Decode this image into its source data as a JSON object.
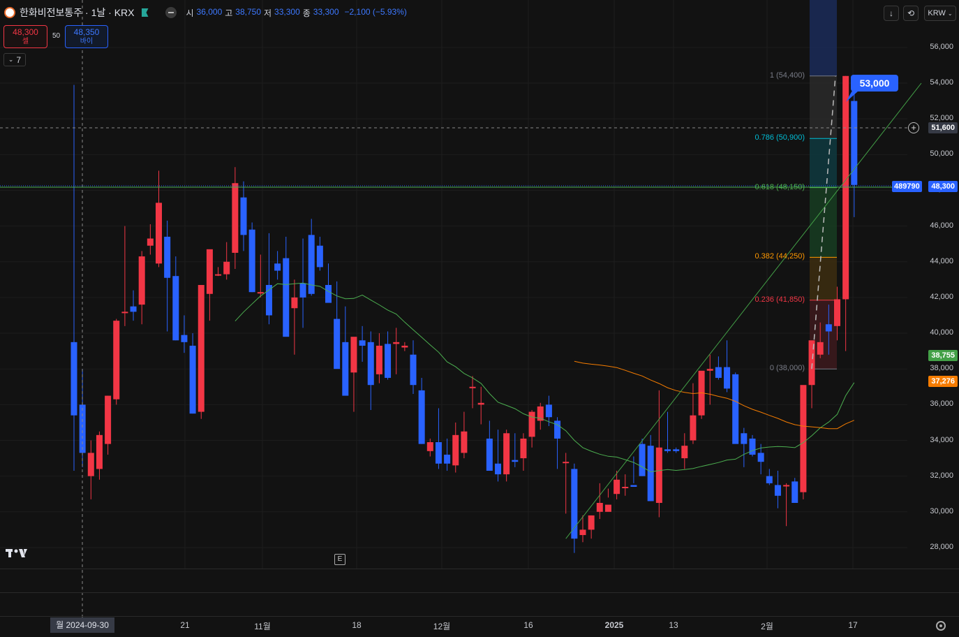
{
  "header": {
    "symbol_title": "한화비전보통주 · 1날 · KRX",
    "ohlc": [
      {
        "k": "시",
        "v": "36,000"
      },
      {
        "k": "고",
        "v": "38,750"
      },
      {
        "k": "저",
        "v": "33,300"
      },
      {
        "k": "종",
        "v": "33,300"
      },
      {
        "k": "",
        "v": "−2,100 (−5.93%)"
      }
    ],
    "sell_price": "48,300",
    "sell_label": "셀",
    "spread": "50",
    "buy_price": "48,350",
    "buy_label": "바이",
    "indicator_count": "7",
    "currency": "KRW"
  },
  "toolbar": {
    "download_icon": "↓",
    "refresh_icon": "⟲"
  },
  "price_axis": {
    "ticks": [
      "56,000",
      "54,000",
      "52,000",
      "50,000",
      "48,000",
      "46,000",
      "44,000",
      "42,000",
      "40,000",
      "38,000",
      "36,000",
      "34,000",
      "32,000",
      "30,000",
      "28,000"
    ],
    "crosshair_price": "51,600",
    "last_price": "48,300",
    "last_volume_tag": "489790",
    "ma_green_value": "38,755",
    "ma_orange_value": "37,276",
    "callout_price": "53,000"
  },
  "time_axis": {
    "ticks": [
      "21",
      "11월",
      "18",
      "12월",
      "16",
      "2025",
      "13",
      "2월",
      "17"
    ],
    "crosshair_date": "월 2024-09-30"
  },
  "fib": [
    {
      "label": "1 (54,400)",
      "color": "#787b86"
    },
    {
      "label": "0.786 (50,900)",
      "color": "#00bcd4"
    },
    {
      "label": "0.618 (48,150)",
      "color": "#4caf50"
    },
    {
      "label": "0.382 (44,250)",
      "color": "#ff9800"
    },
    {
      "label": "0.236 (41,850)",
      "color": "#f23645"
    },
    {
      "label": "0 (38,000)",
      "color": "#787b86"
    }
  ],
  "colors": {
    "up": "#f23645",
    "down": "#2962ff",
    "ma_green": "#4caf50",
    "ma_orange": "#f57c00",
    "background": "#121212"
  },
  "chart_data": {
    "type": "candlestick",
    "ylim": [
      27500,
      57000
    ],
    "candles": [
      {
        "o": 39500,
        "h": 53900,
        "l": 32300,
        "c": 35400
      },
      {
        "o": 36000,
        "h": 38000,
        "l": 32500,
        "c": 33300
      },
      {
        "o": 32000,
        "h": 34000,
        "l": 30700,
        "c": 33300
      },
      {
        "o": 32400,
        "h": 34500,
        "l": 31800,
        "c": 34300
      },
      {
        "o": 33800,
        "h": 36500,
        "l": 33200,
        "c": 36500
      },
      {
        "o": 36300,
        "h": 40800,
        "l": 36000,
        "c": 40700
      },
      {
        "o": 41200,
        "h": 46000,
        "l": 40400,
        "c": 41200
      },
      {
        "o": 41500,
        "h": 42400,
        "l": 40700,
        "c": 41200
      },
      {
        "o": 41600,
        "h": 44600,
        "l": 40500,
        "c": 44300
      },
      {
        "o": 44900,
        "h": 46100,
        "l": 44400,
        "c": 45300
      },
      {
        "o": 43900,
        "h": 49100,
        "l": 43700,
        "c": 47300
      },
      {
        "o": 45400,
        "h": 46300,
        "l": 40100,
        "c": 43100
      },
      {
        "o": 43200,
        "h": 44300,
        "l": 39600,
        "c": 39600
      },
      {
        "o": 39900,
        "h": 41000,
        "l": 38900,
        "c": 39500
      },
      {
        "o": 39300,
        "h": 40000,
        "l": 35500,
        "c": 35500
      },
      {
        "o": 35600,
        "h": 41600,
        "l": 35200,
        "c": 42700
      },
      {
        "o": 42200,
        "h": 44300,
        "l": 40700,
        "c": 44700
      },
      {
        "o": 43300,
        "h": 43700,
        "l": 43200,
        "c": 43300
      },
      {
        "o": 43300,
        "h": 45100,
        "l": 43000,
        "c": 44000
      },
      {
        "o": 44500,
        "h": 49300,
        "l": 43600,
        "c": 48400
      },
      {
        "o": 47600,
        "h": 48500,
        "l": 44600,
        "c": 45500
      },
      {
        "o": 45800,
        "h": 46200,
        "l": 42300,
        "c": 42300
      },
      {
        "o": 42300,
        "h": 44400,
        "l": 42000,
        "c": 42300
      },
      {
        "o": 42700,
        "h": 45600,
        "l": 40500,
        "c": 41000
      },
      {
        "o": 43900,
        "h": 44600,
        "l": 43000,
        "c": 43500
      },
      {
        "o": 44200,
        "h": 45400,
        "l": 41100,
        "c": 39800
      },
      {
        "o": 41400,
        "h": 43000,
        "l": 38800,
        "c": 42000
      },
      {
        "o": 42800,
        "h": 45300,
        "l": 40300,
        "c": 42000
      },
      {
        "o": 45500,
        "h": 46400,
        "l": 42100,
        "c": 42200
      },
      {
        "o": 44900,
        "h": 45400,
        "l": 43500,
        "c": 43700
      },
      {
        "o": 42700,
        "h": 43900,
        "l": 41800,
        "c": 41700
      },
      {
        "o": 40800,
        "h": 42900,
        "l": 38300,
        "c": 38000
      },
      {
        "o": 39500,
        "h": 41500,
        "l": 38700,
        "c": 36500
      },
      {
        "o": 37800,
        "h": 39300,
        "l": 35600,
        "c": 39800
      },
      {
        "o": 39600,
        "h": 40400,
        "l": 38400,
        "c": 39300
      },
      {
        "o": 39500,
        "h": 40100,
        "l": 35700,
        "c": 37100
      },
      {
        "o": 37700,
        "h": 40000,
        "l": 37200,
        "c": 39300
      },
      {
        "o": 39400,
        "h": 40100,
        "l": 37400,
        "c": 37500
      },
      {
        "o": 39400,
        "h": 40300,
        "l": 37700,
        "c": 39500
      },
      {
        "o": 39200,
        "h": 39500,
        "l": 39000,
        "c": 39300
      },
      {
        "o": 38800,
        "h": 39600,
        "l": 36600,
        "c": 37100
      },
      {
        "o": 36800,
        "h": 37500,
        "l": 33800,
        "c": 33800
      },
      {
        "o": 33400,
        "h": 34100,
        "l": 33100,
        "c": 33900
      },
      {
        "o": 33900,
        "h": 35800,
        "l": 32400,
        "c": 32700
      },
      {
        "o": 33200,
        "h": 34100,
        "l": 32300,
        "c": 32700
      },
      {
        "o": 32600,
        "h": 35000,
        "l": 32200,
        "c": 34300
      },
      {
        "o": 33300,
        "h": 35600,
        "l": 33000,
        "c": 34500
      },
      {
        "o": 37000,
        "h": 37600,
        "l": 35800,
        "c": 37000
      },
      {
        "o": 36000,
        "h": 37000,
        "l": 34900,
        "c": 36100
      },
      {
        "o": 34100,
        "h": 35100,
        "l": 32600,
        "c": 32300
      },
      {
        "o": 32700,
        "h": 34600,
        "l": 31700,
        "c": 32100
      },
      {
        "o": 32100,
        "h": 34600,
        "l": 31700,
        "c": 34400
      },
      {
        "o": 32900,
        "h": 34400,
        "l": 32500,
        "c": 32800
      },
      {
        "o": 33000,
        "h": 34400,
        "l": 32300,
        "c": 34100
      },
      {
        "o": 34200,
        "h": 35700,
        "l": 33600,
        "c": 35600
      },
      {
        "o": 35100,
        "h": 36100,
        "l": 34600,
        "c": 35900
      },
      {
        "o": 36000,
        "h": 36500,
        "l": 34800,
        "c": 35300
      },
      {
        "o": 35100,
        "h": 35300,
        "l": 32400,
        "c": 34100
      },
      {
        "o": 32800,
        "h": 33300,
        "l": 29900,
        "c": 32800
      },
      {
        "o": 32400,
        "h": 32700,
        "l": 27700,
        "c": 28500
      },
      {
        "o": 28700,
        "h": 29800,
        "l": 28300,
        "c": 29000
      },
      {
        "o": 29000,
        "h": 29800,
        "l": 28500,
        "c": 29800
      },
      {
        "o": 30000,
        "h": 31600,
        "l": 29600,
        "c": 30500
      },
      {
        "o": 30000,
        "h": 31300,
        "l": 30800,
        "c": 30400
      },
      {
        "o": 31000,
        "h": 32300,
        "l": 30700,
        "c": 31800
      },
      {
        "o": 31400,
        "h": 32100,
        "l": 30900,
        "c": 31400
      },
      {
        "o": 31500,
        "h": 33100,
        "l": 31600,
        "c": 31400
      },
      {
        "o": 33800,
        "h": 34100,
        "l": 32000,
        "c": 32000
      },
      {
        "o": 33700,
        "h": 34300,
        "l": 30600,
        "c": 30600
      },
      {
        "o": 30500,
        "h": 36800,
        "l": 29700,
        "c": 33600
      },
      {
        "o": 33500,
        "h": 35600,
        "l": 33300,
        "c": 33400
      },
      {
        "o": 33500,
        "h": 33600,
        "l": 33300,
        "c": 33400
      },
      {
        "o": 33000,
        "h": 34400,
        "l": 32400,
        "c": 33700
      },
      {
        "o": 34000,
        "h": 37200,
        "l": 33800,
        "c": 35400
      },
      {
        "o": 35400,
        "h": 37200,
        "l": 35200,
        "c": 37900
      },
      {
        "o": 37900,
        "h": 38800,
        "l": 36000,
        "c": 38000
      },
      {
        "o": 38100,
        "h": 38700,
        "l": 37400,
        "c": 37500
      },
      {
        "o": 38100,
        "h": 39600,
        "l": 36700,
        "c": 36900
      },
      {
        "o": 37700,
        "h": 37800,
        "l": 34900,
        "c": 33800
      },
      {
        "o": 34400,
        "h": 34700,
        "l": 32500,
        "c": 33800
      },
      {
        "o": 34100,
        "h": 34300,
        "l": 33100,
        "c": 33200
      },
      {
        "o": 33300,
        "h": 33800,
        "l": 32100,
        "c": 32800
      },
      {
        "o": 32000,
        "h": 32400,
        "l": 31500,
        "c": 31600
      },
      {
        "o": 31500,
        "h": 32300,
        "l": 30200,
        "c": 30900
      },
      {
        "o": 31500,
        "h": 31600,
        "l": 29200,
        "c": 31500
      },
      {
        "o": 31700,
        "h": 31900,
        "l": 31500,
        "c": 30500
      },
      {
        "o": 31100,
        "h": 32800,
        "l": 30700,
        "c": 37100
      },
      {
        "o": 37100,
        "h": 38700,
        "l": 35800,
        "c": 39600
      },
      {
        "o": 38800,
        "h": 40600,
        "l": 38600,
        "c": 39500
      },
      {
        "o": 40500,
        "h": 41600,
        "l": 38800,
        "c": 40100
      },
      {
        "o": 40400,
        "h": 42600,
        "l": 39600,
        "c": 41900
      },
      {
        "o": 41900,
        "h": 54400,
        "l": 39000,
        "c": 54400
      },
      {
        "o": 53000,
        "h": 54400,
        "l": 46500,
        "c": 48300
      }
    ]
  }
}
